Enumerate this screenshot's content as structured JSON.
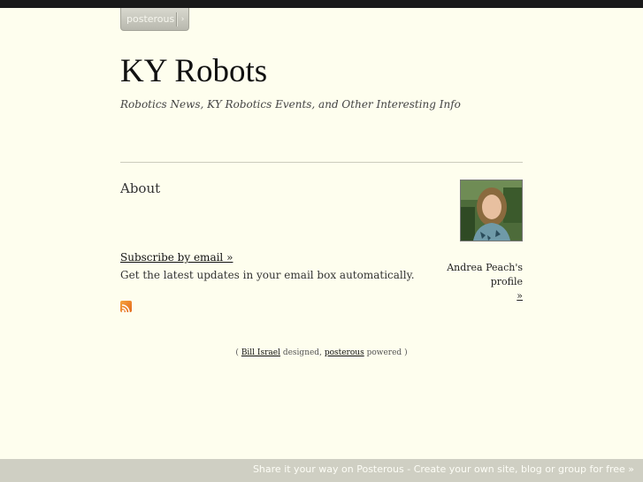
{
  "brand": {
    "button_label": "posterous",
    "arrow": "›"
  },
  "site": {
    "title": "KY Robots",
    "tagline": "Robotics News, KY Robotics Events, and Other Interesting Info"
  },
  "main": {
    "heading": "About",
    "subscribe_link": "Subscribe by email »",
    "subscribe_desc": "Get the latest updates in your email box automatically.",
    "rss_icon": "rss-feed-icon"
  },
  "profile": {
    "name_label": "Andrea Peach's profile",
    "arrow": "»"
  },
  "credits": {
    "open": "(",
    "designer": "Bill Israel",
    "designed": "designed,",
    "platform": "posterous",
    "powered": "powered",
    "close": ")"
  },
  "footer": {
    "cta": "Share it your way on Posterous - Create your own site, blog or group for free »"
  },
  "colors": {
    "background": "#fefeee",
    "top_bar": "#1a1a1a",
    "footer_bar": "#cfcfc3",
    "rss": "#e2691a"
  }
}
